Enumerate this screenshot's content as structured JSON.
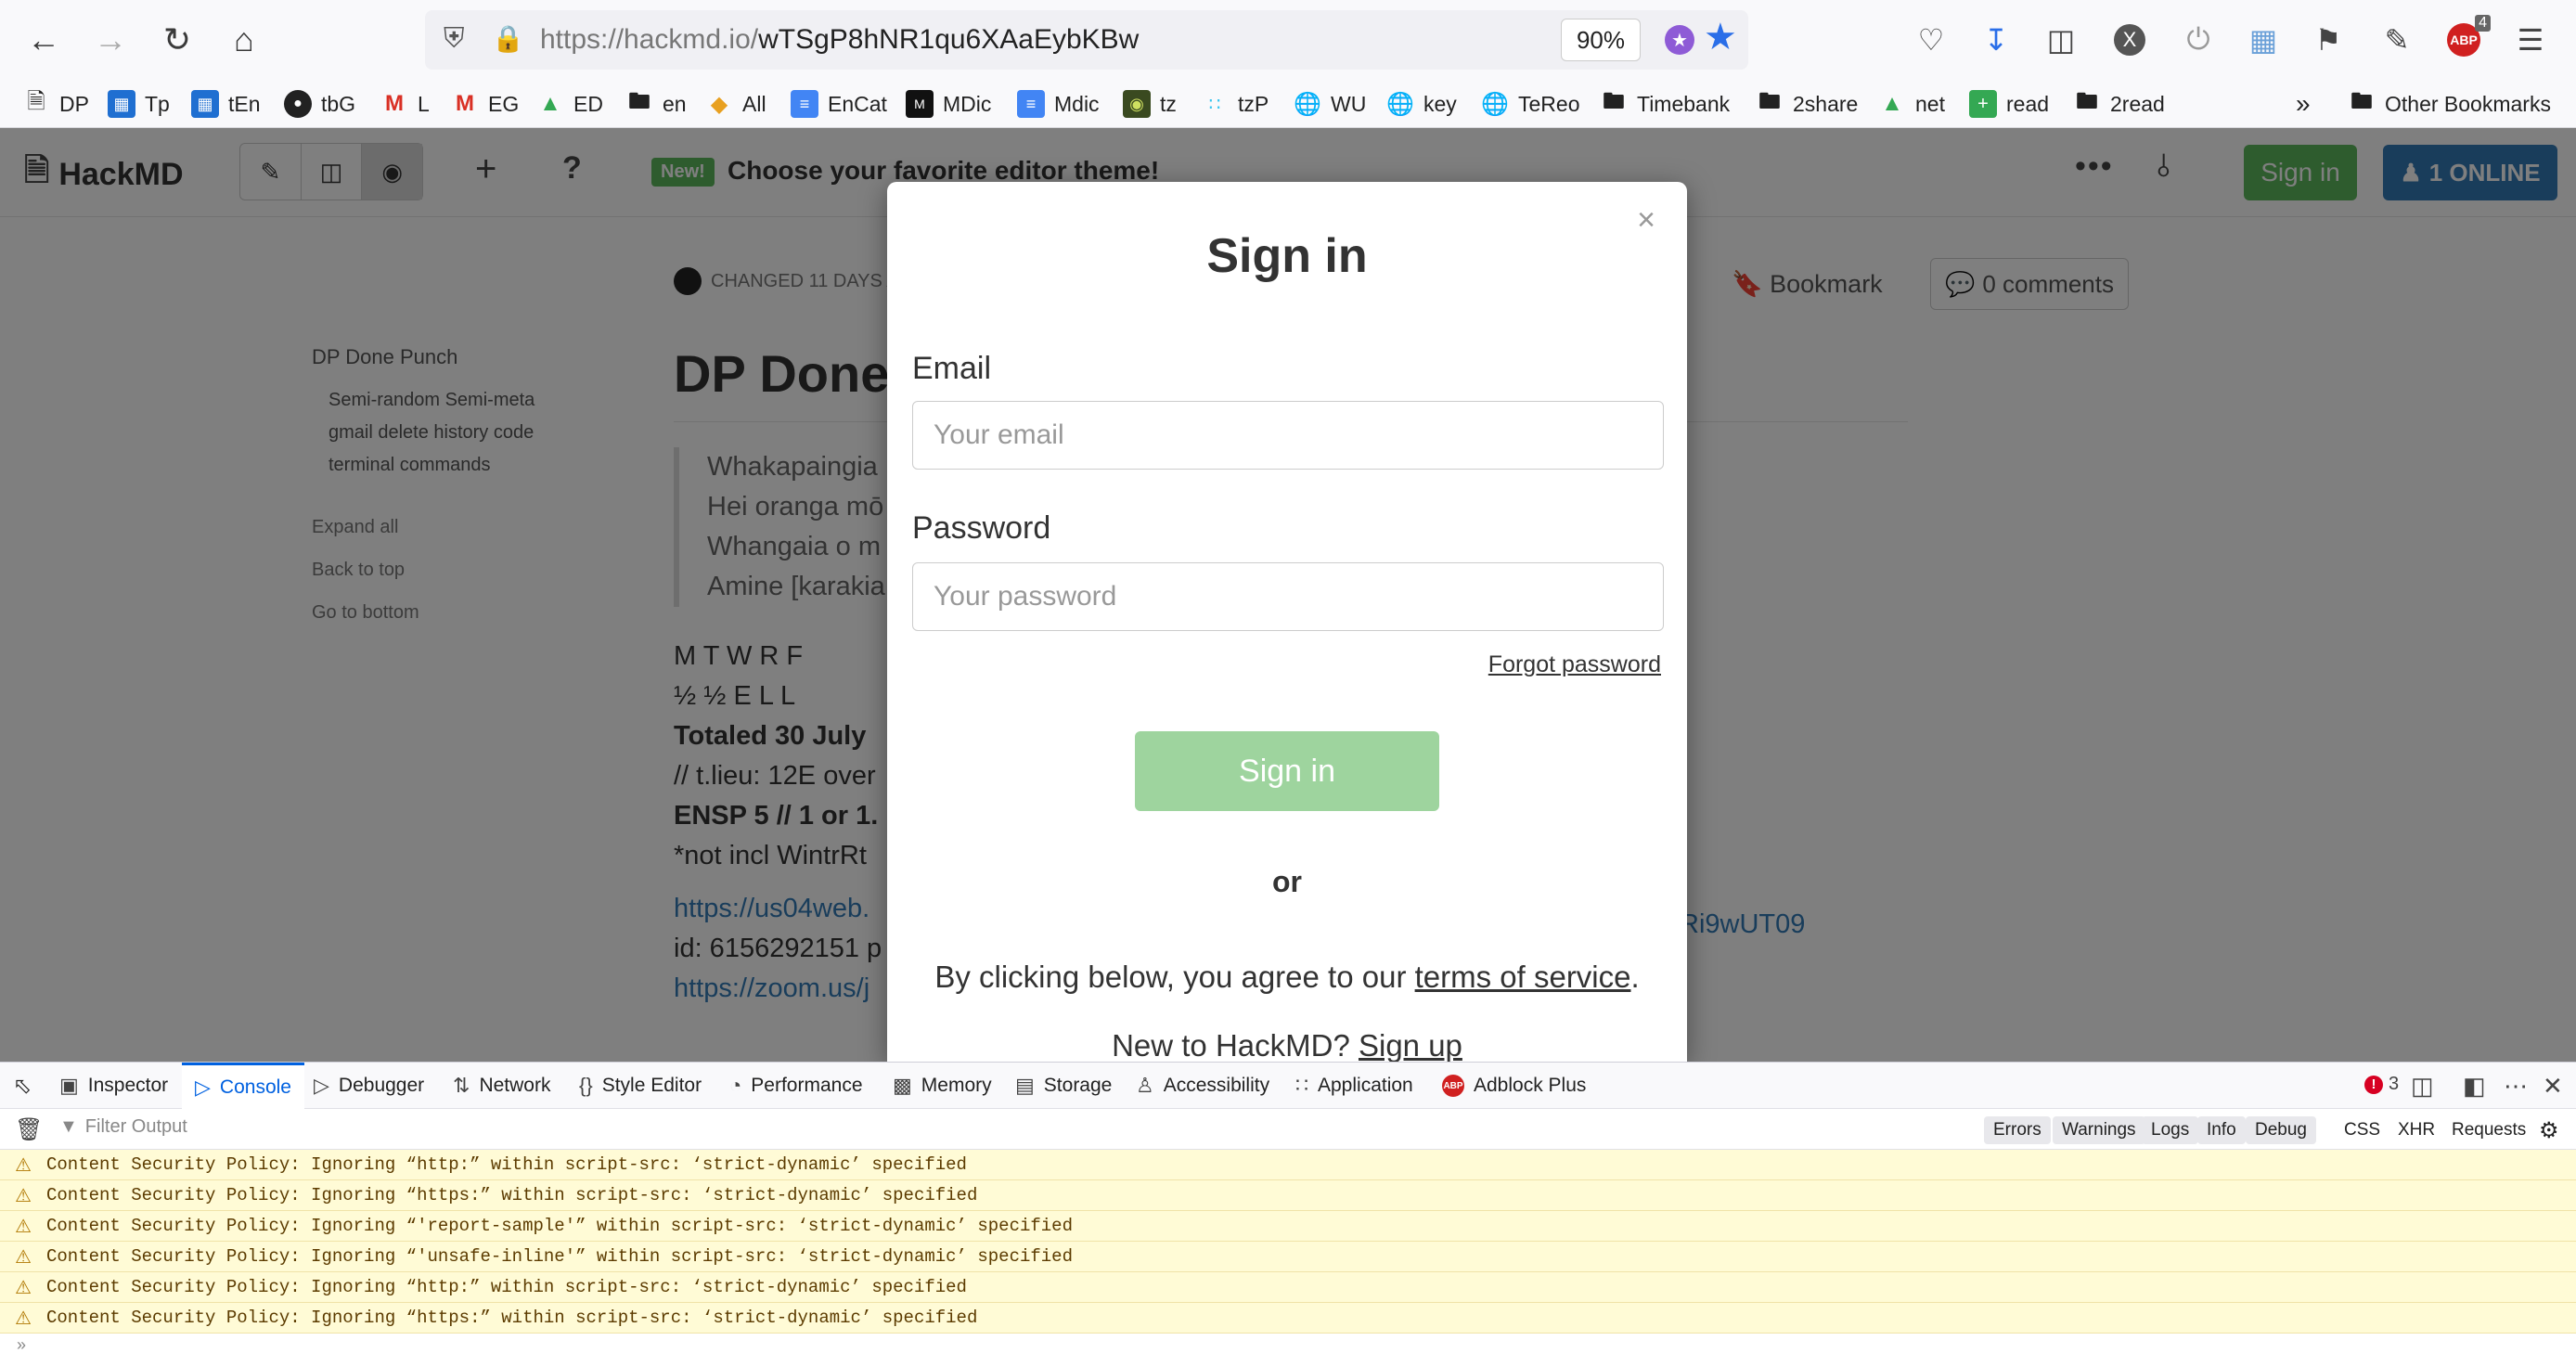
{
  "browser": {
    "url_host": "https://hackmd.io/",
    "url_path": "wTSgP8hNR1qu6XAaEybKBw",
    "zoom": "90%",
    "adblock_count": "4",
    "bookmarks": [
      {
        "label": "DP",
        "icon": "document-icon"
      },
      {
        "label": "Tp",
        "icon": "trello-icon"
      },
      {
        "label": "tEn",
        "icon": "trello-icon"
      },
      {
        "label": "tbG",
        "icon": "github-icon"
      },
      {
        "label": "L",
        "icon": "gmail-icon"
      },
      {
        "label": "EG",
        "icon": "gmail-icon"
      },
      {
        "label": "ED",
        "icon": "drive-icon"
      },
      {
        "label": "en",
        "icon": "folder-icon"
      },
      {
        "label": "All",
        "icon": "app-icon"
      },
      {
        "label": "EnCat",
        "icon": "docs-icon"
      },
      {
        "label": "MDic",
        "icon": "mdic-icon"
      },
      {
        "label": "Mdic",
        "icon": "docs-icon"
      },
      {
        "label": "tz",
        "icon": "app-icon"
      },
      {
        "label": "tzP",
        "icon": "slack-icon"
      },
      {
        "label": "WU",
        "icon": "globe-icon"
      },
      {
        "label": "key",
        "icon": "globe-icon"
      },
      {
        "label": "TeReo",
        "icon": "globe-icon"
      },
      {
        "label": "Timebank",
        "icon": "folder-icon"
      },
      {
        "label": "2share",
        "icon": "folder-icon"
      },
      {
        "label": "net",
        "icon": "drive-icon"
      },
      {
        "label": "read",
        "icon": "sheets-icon"
      },
      {
        "label": "2read",
        "icon": "folder-icon"
      }
    ],
    "other_bookmarks": "Other Bookmarks"
  },
  "hackmd": {
    "logo": "HackMD",
    "new_badge": "New!",
    "theme_message": "Choose your favorite editor theme!",
    "signin_label": "Sign in",
    "online_label": "1 ONLINE",
    "meta": "CHANGED 11 DAYS A",
    "bookmark_label": "Bookmark",
    "comments_label": "0 comments",
    "toc": {
      "title": "DP Done Punch",
      "items": [
        "Semi-random Semi-meta",
        "gmail delete history code",
        "terminal commands"
      ],
      "links": [
        "Expand all",
        "Back to top",
        "Go to bottom"
      ]
    },
    "doc_title": "DP Done",
    "quote_lines": [
      "Whakapaingia",
      "Hei oranga mō",
      "Whangaia o m",
      "Amine [karakia"
    ],
    "body_lines": [
      {
        "text": "M T W R F",
        "style": "normal"
      },
      {
        "text": "½ ½ E L L",
        "style": "normal"
      },
      {
        "text": "Totaled 30 July",
        "style": "bold"
      },
      {
        "text": "// t.lieu: 12E over",
        "style": "normal"
      },
      {
        "text": "ENSP 5 // 1 or 1.",
        "style": "bold"
      },
      {
        "text": "*not incl WintrRt",
        "style": "normal"
      },
      {
        "text": "https://us04web.",
        "style": "link"
      },
      {
        "text": "id: 6156292151 p",
        "style": "normal"
      },
      {
        "text": "https://zoom.us/j",
        "style": "link"
      }
    ],
    "link_tail": "Ri9wUT09"
  },
  "modal": {
    "title": "Sign in",
    "email_label": "Email",
    "email_placeholder": "Your email",
    "password_label": "Password",
    "password_placeholder": "Your password",
    "forgot": "Forgot password",
    "submit": "Sign in",
    "or": "or",
    "tos_prefix": "By clicking below, you agree to our ",
    "tos_link": "terms of service",
    "tos_suffix": ".",
    "signup_prefix": "New to HackMD? ",
    "signup_link": "Sign up"
  },
  "devtools": {
    "tabs": [
      "Inspector",
      "Console",
      "Debugger",
      "Network",
      "Style Editor",
      "Performance",
      "Memory",
      "Storage",
      "Accessibility",
      "Application",
      "Adblock Plus"
    ],
    "active_tab": "Console",
    "error_count": "3",
    "filter_placeholder": "Filter Output",
    "levels": [
      "Errors",
      "Warnings",
      "Logs",
      "Info",
      "Debug"
    ],
    "extra": [
      "CSS",
      "XHR",
      "Requests"
    ],
    "messages": [
      "Content Security Policy: Ignoring “http:” within script-src: ‘strict-dynamic’ specified",
      "Content Security Policy: Ignoring “https:” within script-src: ‘strict-dynamic’ specified",
      "Content Security Policy: Ignoring “'report-sample'” within script-src: ‘strict-dynamic’ specified",
      "Content Security Policy: Ignoring “'unsafe-inline'” within script-src: ‘strict-dynamic’ specified",
      "Content Security Policy: Ignoring “http:” within script-src: ‘strict-dynamic’ specified",
      "Content Security Policy: Ignoring “https:” within script-src: ‘strict-dynamic’ specified"
    ]
  },
  "colors": {
    "hackmd_green": "#5cb85c",
    "hackmd_blue": "#337ab7",
    "submit_disabled": "#9ed49e",
    "devtools_accent": "#0061e0",
    "warning_bg": "#fffbd6"
  }
}
